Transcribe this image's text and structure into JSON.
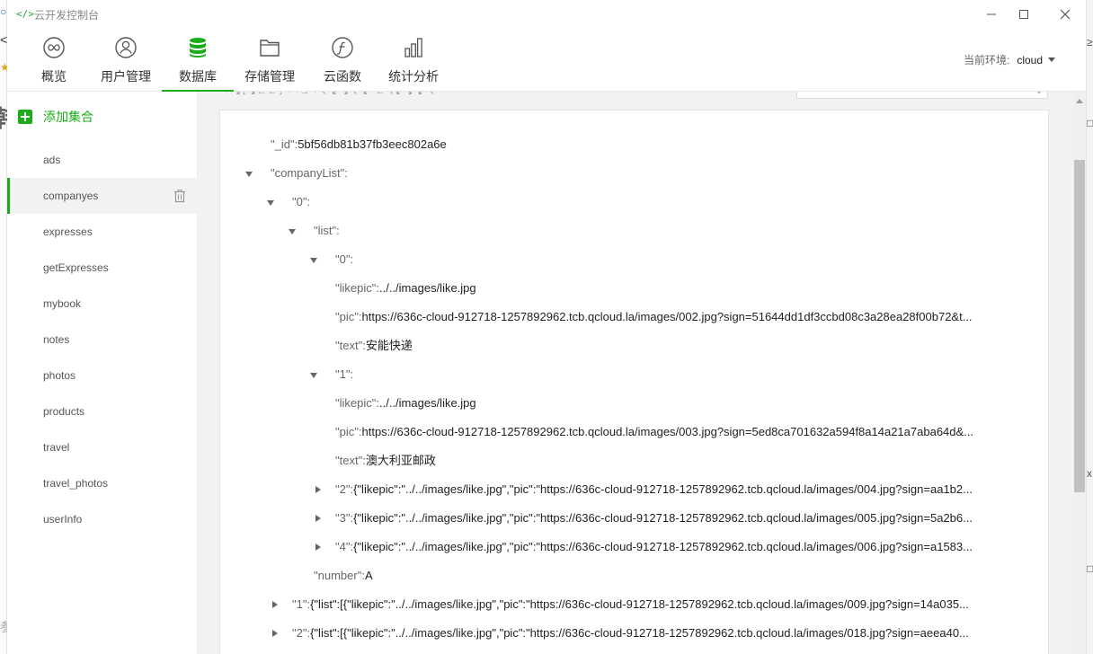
{
  "window": {
    "title": "云开发控制台",
    "app_icon": "code-brackets-icon",
    "controls": [
      "minimize-icon",
      "maximize-icon",
      "close-icon"
    ]
  },
  "background_fragments": {
    "left": [
      "○",
      "<",
      "★",
      "韩",
      "参"
    ],
    "right": [
      "≥",
      "□",
      "x",
      "□"
    ]
  },
  "nav": {
    "items": [
      {
        "label": "概览",
        "icon": "overview-infinity-icon"
      },
      {
        "label": "用户管理",
        "icon": "user-icon"
      },
      {
        "label": "数据库",
        "icon": "database-icon",
        "active": true
      },
      {
        "label": "存储管理",
        "icon": "folder-icon"
      },
      {
        "label": "云函数",
        "icon": "function-icon"
      },
      {
        "label": "统计分析",
        "icon": "bar-chart-icon"
      }
    ],
    "env_label": "当前环境:",
    "env_value": "cloud",
    "accent_color": "#1aad19"
  },
  "sidebar": {
    "add_label": "添加集合",
    "collections": [
      "ads",
      "companyes",
      "expresses",
      "getExpresses",
      "mybook",
      "notes",
      "photos",
      "products",
      "travel",
      "travel_photos",
      "userInfo"
    ],
    "selected": "companyes"
  },
  "toolbar_fragment": {
    "text": "· ↘↓↘←←↓ · ·→ ·↖ ↙↘↖ ↙ ←↖↙↘ ↙↖"
  },
  "document": {
    "lines": [
      {
        "key": "\"_id\"",
        "value": "5bf56db81b37fb3eec802a6e"
      },
      {
        "key": "\"companyList\"",
        "value": ""
      },
      {
        "key": "\"0\"",
        "value": ""
      },
      {
        "key": "\"list\"",
        "value": ""
      },
      {
        "key": "\"0\"",
        "value": ""
      },
      {
        "key": "\"likepic\"",
        "value": "../../images/like.jpg"
      },
      {
        "key": "\"pic\"",
        "value": "https://636c-cloud-912718-1257892962.tcb.qcloud.la/images/002.jpg?sign=51644dd1df3ccbd08c3a28ea28f00b72&t..."
      },
      {
        "key": "\"text\"",
        "value": "安能快递"
      },
      {
        "key": "\"1\"",
        "value": ""
      },
      {
        "key": "\"likepic\"",
        "value": "../../images/like.jpg"
      },
      {
        "key": "\"pic\"",
        "value": "https://636c-cloud-912718-1257892962.tcb.qcloud.la/images/003.jpg?sign=5ed8ca701632a594f8a14a21a7aba64d&..."
      },
      {
        "key": "\"text\"",
        "value": "澳大利亚邮政"
      },
      {
        "key": "\"2\"",
        "value": "{\"likepic\":\"../../images/like.jpg\",\"pic\":\"https://636c-cloud-912718-1257892962.tcb.qcloud.la/images/004.jpg?sign=aa1b2..."
      },
      {
        "key": "\"3\"",
        "value": "{\"likepic\":\"../../images/like.jpg\",\"pic\":\"https://636c-cloud-912718-1257892962.tcb.qcloud.la/images/005.jpg?sign=5a2b6..."
      },
      {
        "key": "\"4\"",
        "value": "{\"likepic\":\"../../images/like.jpg\",\"pic\":\"https://636c-cloud-912718-1257892962.tcb.qcloud.la/images/006.jpg?sign=a1583..."
      },
      {
        "key": "\"number\"",
        "value": "A"
      },
      {
        "key": "\"1\"",
        "value": "{\"list\":[{\"likepic\":\"../../images/like.jpg\",\"pic\":\"https://636c-cloud-912718-1257892962.tcb.qcloud.la/images/009.jpg?sign=14a035..."
      },
      {
        "key": "\"2\"",
        "value": "{\"list\":[{\"likepic\":\"../../images/like.jpg\",\"pic\":\"https://636c-cloud-912718-1257892962.tcb.qcloud.la/images/018.jpg?sign=aeea40..."
      }
    ]
  }
}
